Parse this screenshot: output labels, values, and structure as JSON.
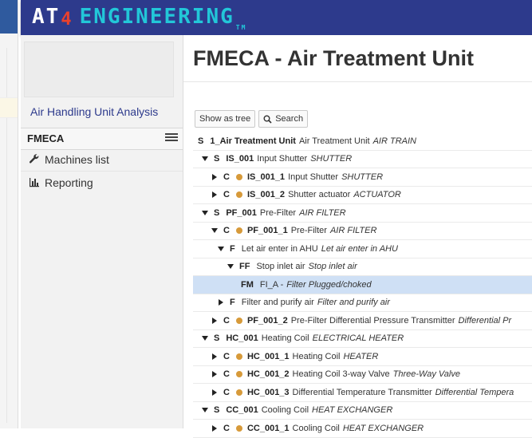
{
  "brand": {
    "logo_text": "ENGINEERING",
    "logo_prefix": "AT",
    "logo_digit": "4",
    "logo_tm": "TM"
  },
  "sidebar": {
    "title": "Air Handling Unit Analysis",
    "section_label": "FMECA",
    "items": [
      {
        "label": "Machines list",
        "icon": "wrench-icon"
      },
      {
        "label": "Reporting",
        "icon": "bar-chart-icon"
      }
    ]
  },
  "main": {
    "title": "FMECA - Air Treatment Unit",
    "toolbar": {
      "show_tree": "Show as tree",
      "search": "Search"
    }
  },
  "tree": [
    {
      "level": 0,
      "toggle": "none",
      "kind": "S",
      "dot": false,
      "code": "1_Air Treatment Unit",
      "name": "Air Treatment Unit",
      "type": "AIR TRAIN"
    },
    {
      "level": 1,
      "toggle": "down",
      "kind": "S",
      "dot": false,
      "code": "IS_001",
      "name": "Input Shutter",
      "type": "SHUTTER"
    },
    {
      "level": 2,
      "toggle": "right",
      "kind": "C",
      "dot": true,
      "code": "IS_001_1",
      "name": "Input Shutter",
      "type": "SHUTTER"
    },
    {
      "level": 2,
      "toggle": "right",
      "kind": "C",
      "dot": true,
      "code": "IS_001_2",
      "name": "Shutter actuator",
      "type": "ACTUATOR"
    },
    {
      "level": 1,
      "toggle": "down",
      "kind": "S",
      "dot": false,
      "code": "PF_001",
      "name": "Pre-Filter",
      "type": "AIR FILTER"
    },
    {
      "level": 2,
      "toggle": "down",
      "kind": "C",
      "dot": true,
      "code": "PF_001_1",
      "name": "Pre-Filter",
      "type": "AIR FILTER"
    },
    {
      "level": 3,
      "toggle": "down",
      "kind": "F",
      "dot": false,
      "code": "",
      "name": "Let air enter in AHU",
      "type": "Let air enter in AHU"
    },
    {
      "level": 4,
      "toggle": "down",
      "kind": "FF",
      "dot": false,
      "code": "",
      "name": "Stop inlet air",
      "type": "Stop inlet air"
    },
    {
      "level": 5,
      "toggle": "none",
      "kind": "FM",
      "dot": false,
      "code": "",
      "name": "FI_A -",
      "type": "Filter Plugged/choked",
      "selected": true
    },
    {
      "level": 3,
      "toggle": "right",
      "kind": "F",
      "dot": false,
      "code": "",
      "name": "Filter and purify air",
      "type": "Filter and purify air"
    },
    {
      "level": 2,
      "toggle": "right",
      "kind": "C",
      "dot": true,
      "code": "PF_001_2",
      "name": "Pre-Filter Differential Pressure Transmitter",
      "type": "Differential Pr"
    },
    {
      "level": 1,
      "toggle": "down",
      "kind": "S",
      "dot": false,
      "code": "HC_001",
      "name": "Heating Coil",
      "type": "ELECTRICAL HEATER"
    },
    {
      "level": 2,
      "toggle": "right",
      "kind": "C",
      "dot": true,
      "code": "HC_001_1",
      "name": "Heating Coil",
      "type": "HEATER"
    },
    {
      "level": 2,
      "toggle": "right",
      "kind": "C",
      "dot": true,
      "code": "HC_001_2",
      "name": "Heating Coil 3-way Valve",
      "type": "Three-Way Valve"
    },
    {
      "level": 2,
      "toggle": "right",
      "kind": "C",
      "dot": true,
      "code": "HC_001_3",
      "name": "Differential Temperature Transmitter",
      "type": "Differential Tempera"
    },
    {
      "level": 1,
      "toggle": "down",
      "kind": "S",
      "dot": false,
      "code": "CC_001",
      "name": "Cooling Coil",
      "type": "HEAT EXCHANGER"
    },
    {
      "level": 2,
      "toggle": "right",
      "kind": "C",
      "dot": true,
      "code": "CC_001_1",
      "name": "Cooling Coil",
      "type": "HEAT EXCHANGER"
    }
  ]
}
